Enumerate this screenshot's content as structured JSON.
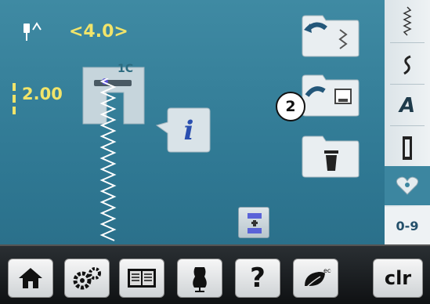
{
  "header": {
    "stitch_width": "<4.0>",
    "stitch_length": "2.00"
  },
  "foot": {
    "label": "1C"
  },
  "badge": {
    "number": "2"
  },
  "sidebar": {
    "items": [
      {
        "icon": "stitch-wave-icon"
      },
      {
        "icon": "stitch-s-icon"
      },
      {
        "icon": "alphabet-icon",
        "label": "A"
      },
      {
        "icon": "buttonhole-icon"
      },
      {
        "icon": "heart-icon"
      },
      {
        "icon": "digits-icon",
        "label": "0-9"
      }
    ]
  },
  "bottom": {
    "clear_label": "clr",
    "help_label": "?",
    "eco_label": "eco"
  },
  "colors": {
    "background": "#3680a0",
    "value_text": "#f1e46a",
    "sidebar": "#e6ecef"
  }
}
